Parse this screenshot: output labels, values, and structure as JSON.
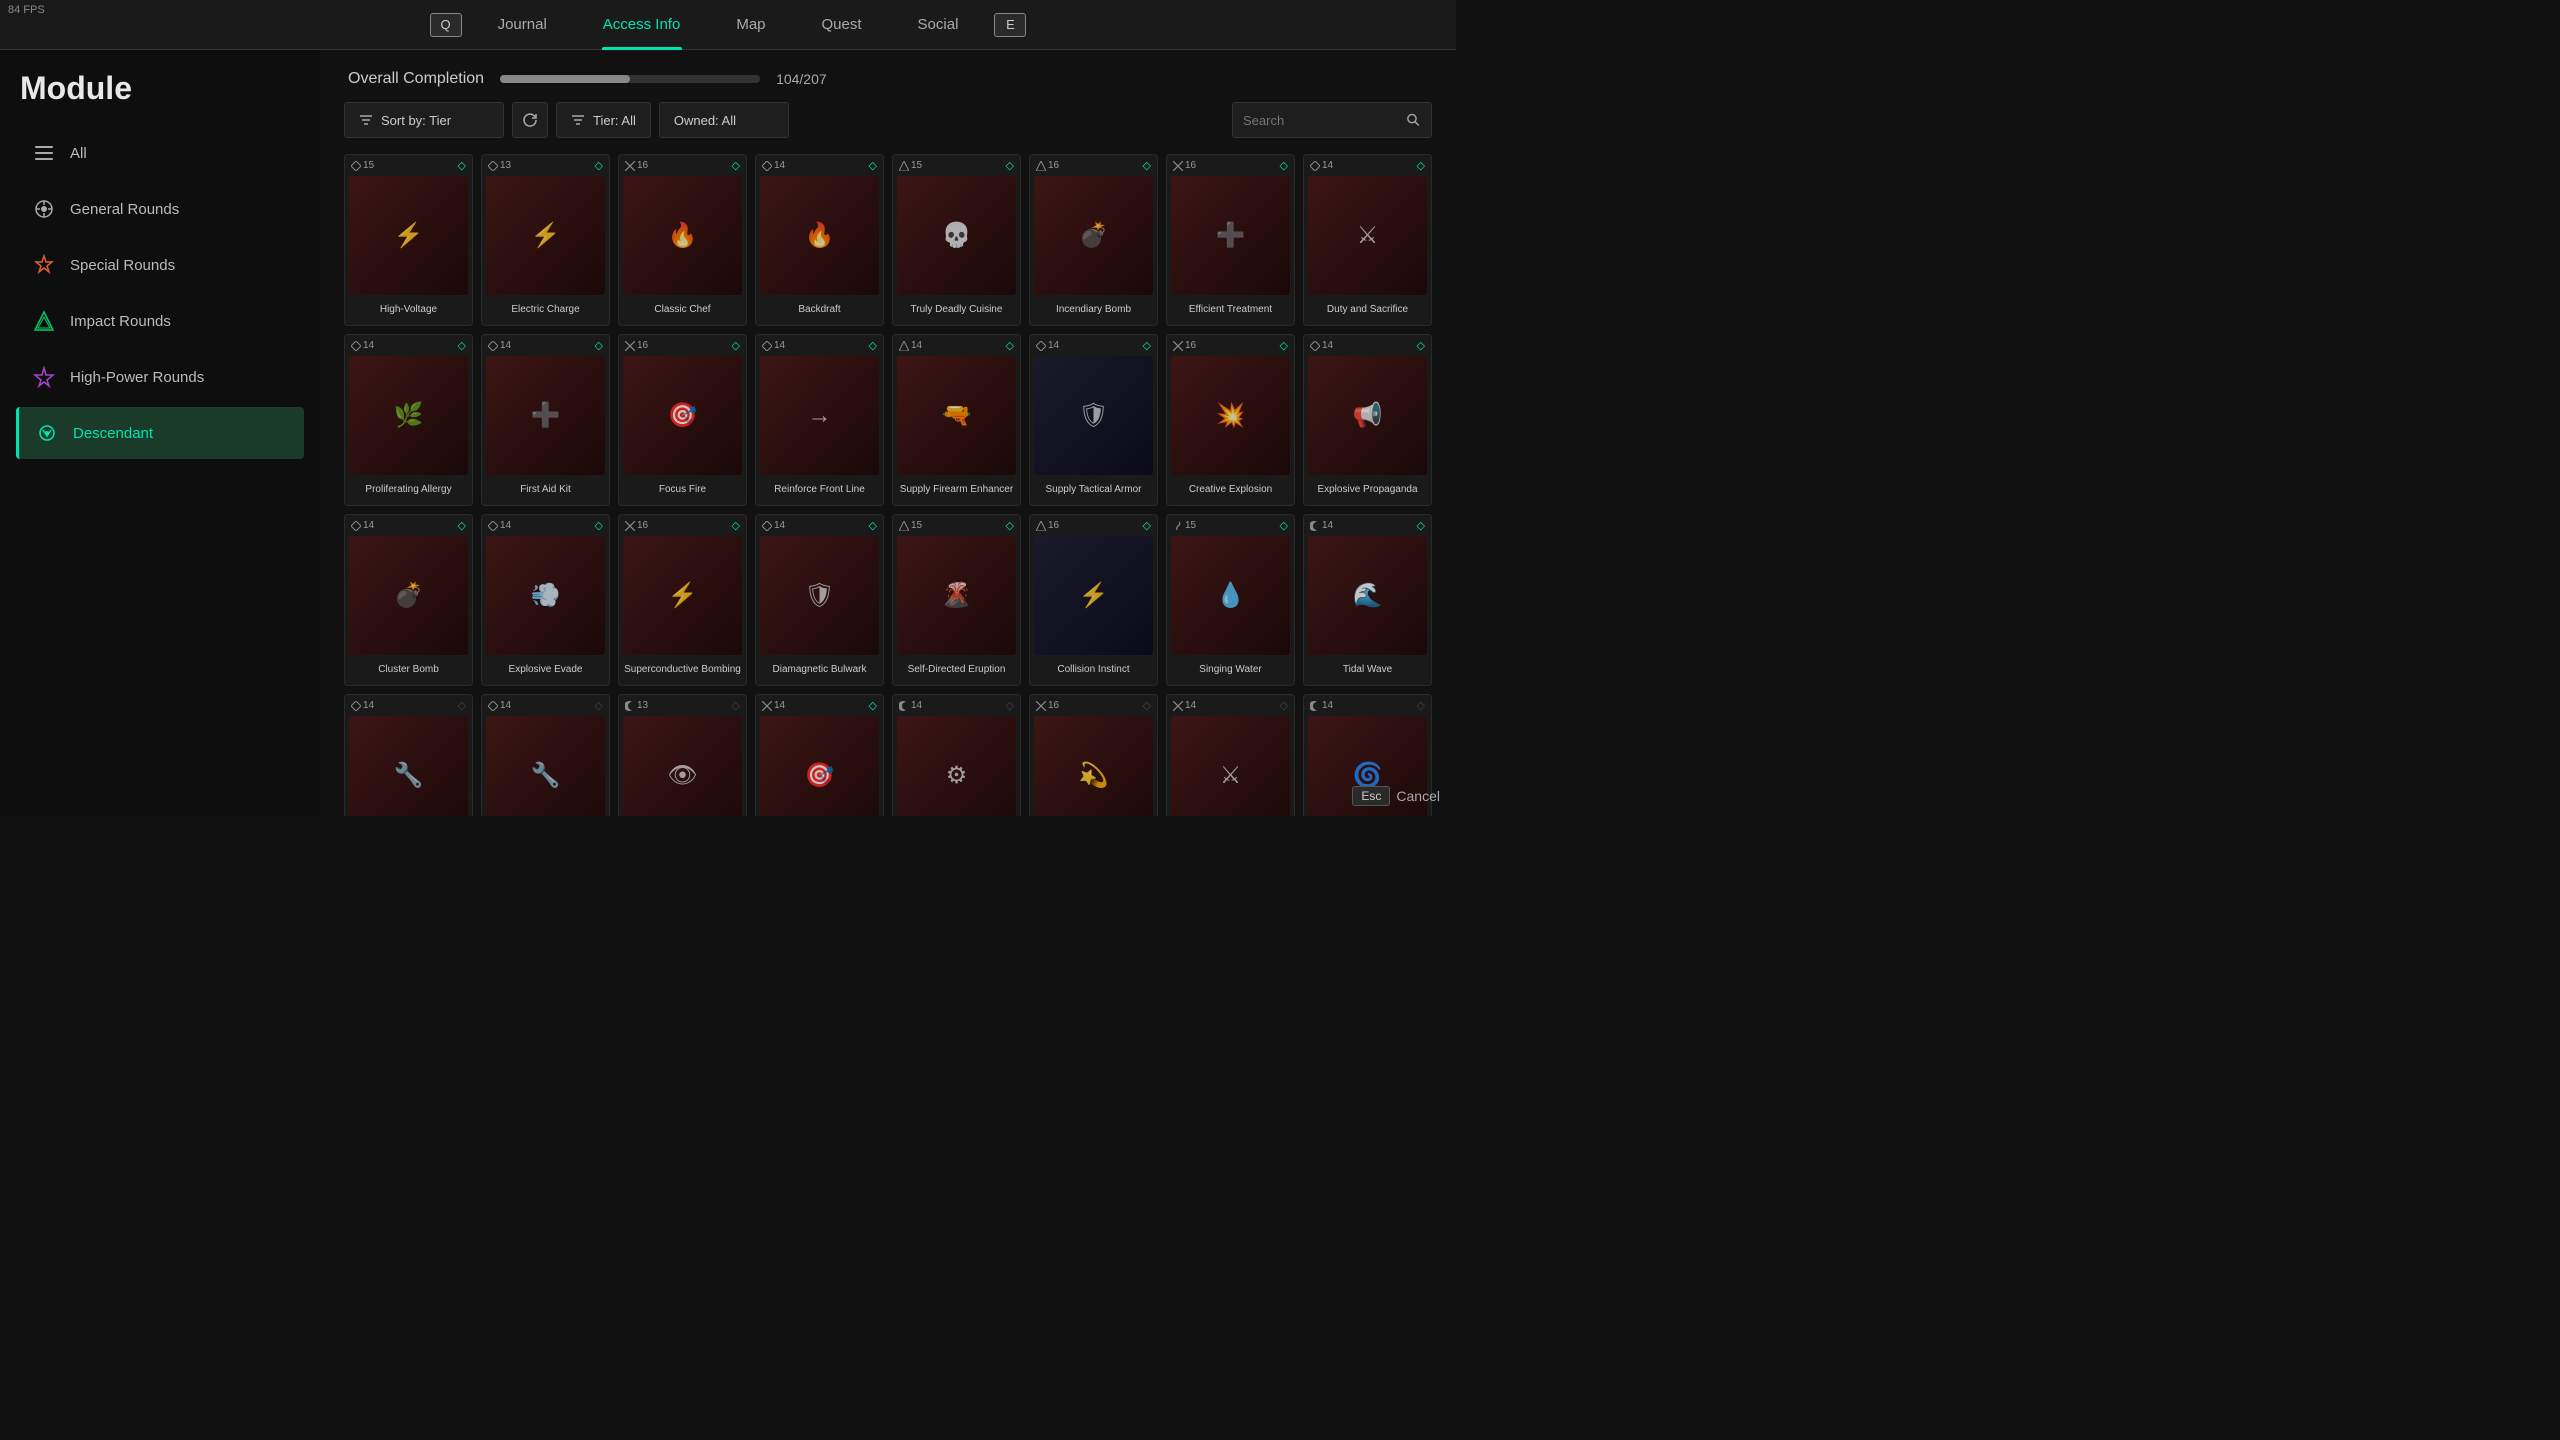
{
  "fps": "84 FPS",
  "nav": {
    "left_key": "Q",
    "right_key": "E",
    "items": [
      {
        "label": "Journal",
        "active": false
      },
      {
        "label": "Access Info",
        "active": true
      },
      {
        "label": "Map",
        "active": false
      },
      {
        "label": "Quest",
        "active": false
      },
      {
        "label": "Social",
        "active": false
      }
    ]
  },
  "sidebar": {
    "title": "Module",
    "items": [
      {
        "label": "All",
        "icon": "≡",
        "active": false
      },
      {
        "label": "General Rounds",
        "icon": "◎",
        "active": false
      },
      {
        "label": "Special Rounds",
        "icon": "◈",
        "active": false
      },
      {
        "label": "Impact Rounds",
        "icon": "◆",
        "active": false
      },
      {
        "label": "High-Power Rounds",
        "icon": "✦",
        "active": false
      },
      {
        "label": "Descendant",
        "icon": "❋",
        "active": true
      }
    ]
  },
  "progress": {
    "label": "Overall Completion",
    "current": 104,
    "total": 207,
    "display": "104/207",
    "percent": 50
  },
  "filters": {
    "sort_label": "Sort by: Tier",
    "tier_label": "Tier: All",
    "owned_label": "Owned: All",
    "search_placeholder": "Search"
  },
  "modules": [
    {
      "name": "High-Voltage",
      "tier": "15",
      "tier_icon": "⬦",
      "owned": true,
      "bg": "red"
    },
    {
      "name": "Electric Charge",
      "tier": "13",
      "tier_icon": "⬦",
      "owned": true,
      "bg": "red"
    },
    {
      "name": "Classic Chef",
      "tier": "16",
      "tier_icon": "✕",
      "owned": true,
      "bg": "red"
    },
    {
      "name": "Backdraft",
      "tier": "14",
      "tier_icon": "⬦",
      "owned": true,
      "bg": "red"
    },
    {
      "name": "Truly Deadly Cuisine",
      "tier": "15",
      "tier_icon": "△",
      "owned": true,
      "bg": "red"
    },
    {
      "name": "Incendiary Bomb",
      "tier": "16",
      "tier_icon": "△",
      "owned": true,
      "bg": "red"
    },
    {
      "name": "Efficient Treatment",
      "tier": "16",
      "tier_icon": "✕",
      "owned": true,
      "bg": "red"
    },
    {
      "name": "Duty and Sacrifice",
      "tier": "14",
      "tier_icon": "⬦",
      "owned": true,
      "bg": "red"
    },
    {
      "name": "Proliferating Allergy",
      "tier": "14",
      "tier_icon": "⬦",
      "owned": true,
      "bg": "red"
    },
    {
      "name": "First Aid Kit",
      "tier": "14",
      "tier_icon": "⬦",
      "owned": true,
      "bg": "red"
    },
    {
      "name": "Focus Fire",
      "tier": "16",
      "tier_icon": "✕",
      "owned": true,
      "bg": "red"
    },
    {
      "name": "Reinforce Front Line",
      "tier": "14",
      "tier_icon": "⬦",
      "owned": true,
      "bg": "red"
    },
    {
      "name": "Supply Firearm Enhancer",
      "tier": "14",
      "tier_icon": "△",
      "owned": true,
      "bg": "red"
    },
    {
      "name": "Supply Tactical Armor",
      "tier": "14",
      "tier_icon": "⬦",
      "owned": true,
      "bg": "dark"
    },
    {
      "name": "Creative Explosion",
      "tier": "16",
      "tier_icon": "✕",
      "owned": true,
      "bg": "red"
    },
    {
      "name": "Explosive Propaganda",
      "tier": "14",
      "tier_icon": "⬦",
      "owned": true,
      "bg": "red"
    },
    {
      "name": "Cluster Bomb",
      "tier": "14",
      "tier_icon": "⬦",
      "owned": true,
      "bg": "red"
    },
    {
      "name": "Explosive Evade",
      "tier": "14",
      "tier_icon": "⬦",
      "owned": true,
      "bg": "red"
    },
    {
      "name": "Superconductive Bombing",
      "tier": "16",
      "tier_icon": "✕",
      "owned": true,
      "bg": "red"
    },
    {
      "name": "Diamagnetic Bulwark",
      "tier": "14",
      "tier_icon": "⬦",
      "owned": true,
      "bg": "red"
    },
    {
      "name": "Self-Directed Eruption",
      "tier": "15",
      "tier_icon": "△",
      "owned": true,
      "bg": "red"
    },
    {
      "name": "Collision Instinct",
      "tier": "16",
      "tier_icon": "△",
      "owned": true,
      "bg": "dark"
    },
    {
      "name": "Singing Water",
      "tier": "15",
      "tier_icon": "∫",
      "owned": true,
      "bg": "red"
    },
    {
      "name": "Tidal Wave",
      "tier": "14",
      "tier_icon": "☾",
      "owned": true,
      "bg": "red"
    },
    {
      "name": "",
      "tier": "14",
      "tier_icon": "⬦",
      "owned": false,
      "bg": "red"
    },
    {
      "name": "",
      "tier": "14",
      "tier_icon": "⬦",
      "owned": false,
      "bg": "red"
    },
    {
      "name": "",
      "tier": "13",
      "tier_icon": "☾",
      "owned": false,
      "bg": "red"
    },
    {
      "name": "",
      "tier": "14",
      "tier_icon": "✕",
      "owned": true,
      "bg": "red"
    },
    {
      "name": "",
      "tier": "14",
      "tier_icon": "☾",
      "owned": false,
      "bg": "red"
    },
    {
      "name": "",
      "tier": "16",
      "tier_icon": "✕",
      "owned": false,
      "bg": "red"
    },
    {
      "name": "",
      "tier": "14",
      "tier_icon": "✕",
      "owned": false,
      "bg": "red"
    },
    {
      "name": "",
      "tier": "14",
      "tier_icon": "☾",
      "owned": false,
      "bg": "red"
    }
  ],
  "module_icons": [
    "⚡",
    "⚡",
    "🍳",
    "🔥",
    "☠",
    "💣",
    "➕",
    "⚔",
    "🌿",
    "➕",
    "🎯",
    "→",
    "🔫",
    "🛡",
    "💥",
    "📢",
    "💣",
    "💨",
    "⚡",
    "🛡",
    "🌋",
    "⚡",
    "💧",
    "🌊",
    "🔧",
    "🔧",
    "👁",
    "🎯",
    "⚙",
    "💫",
    "⚔",
    "🌀"
  ],
  "bottom": {
    "esc_label": "Esc",
    "cancel_label": "Cancel"
  }
}
